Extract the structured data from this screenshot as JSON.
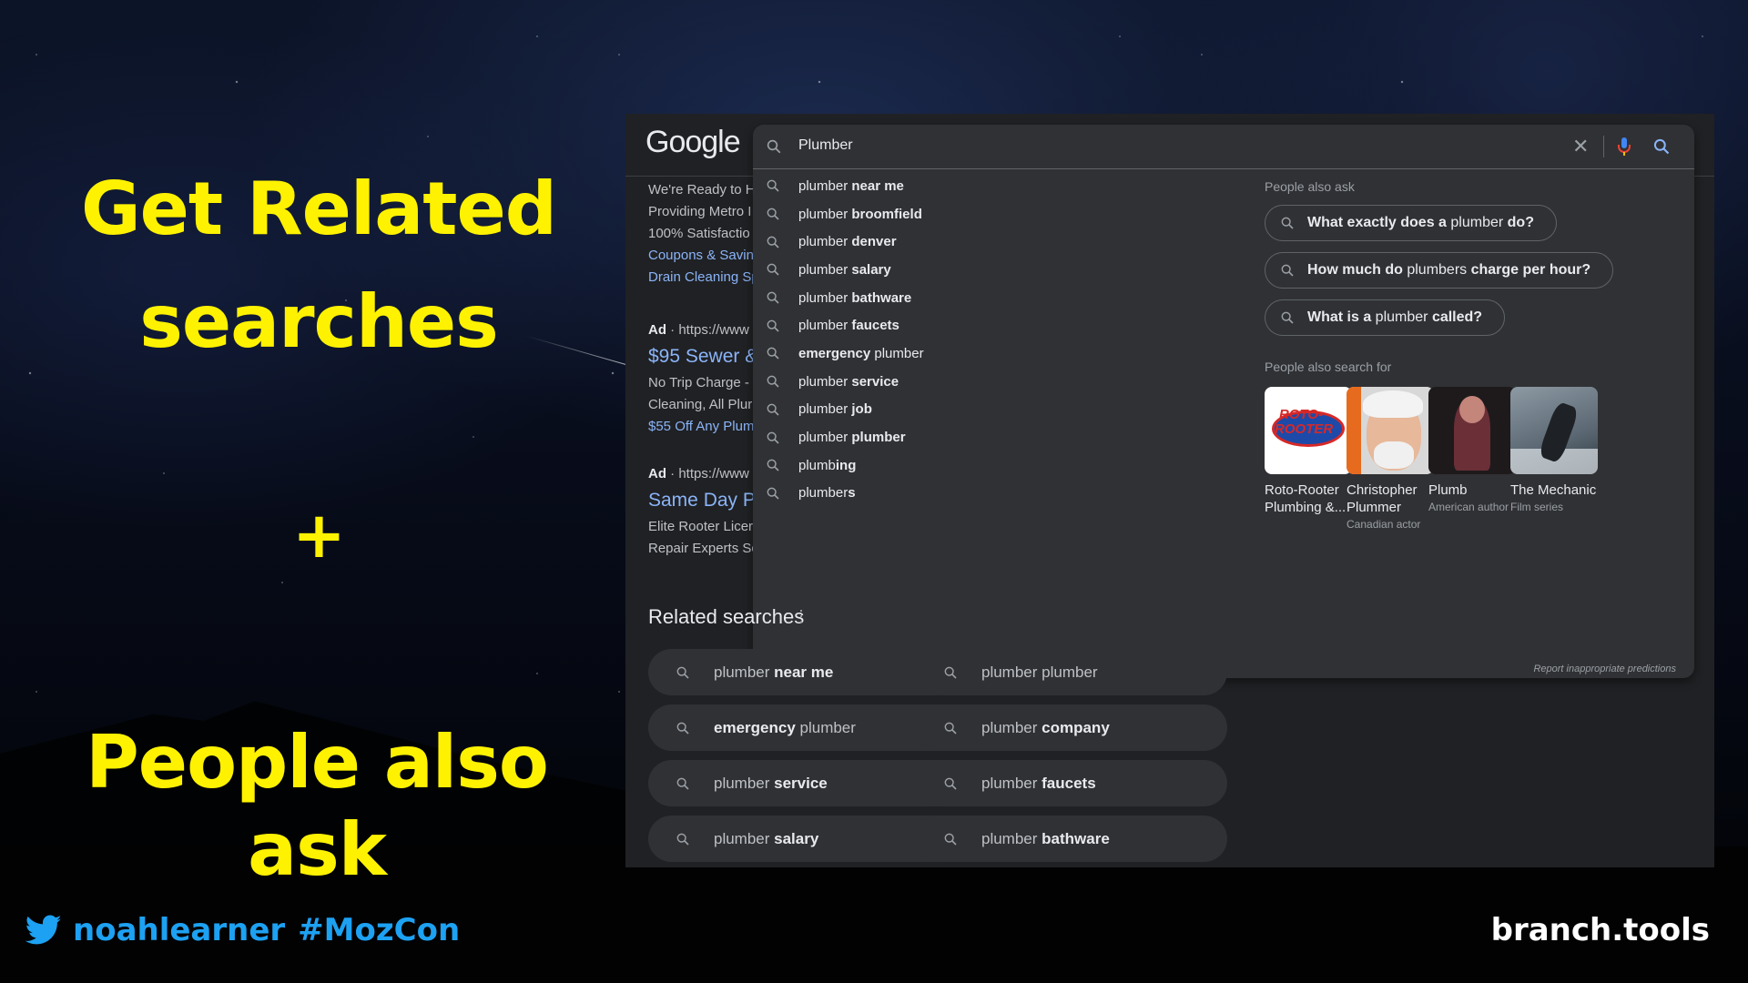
{
  "headline": {
    "line1": "Get Related",
    "line2": "searches",
    "plus": "+",
    "line3": "People also ask"
  },
  "footer": {
    "handle": "noahlearner",
    "hashtag": "#MozCon",
    "site": "branch.tools",
    "twitter_color": "#1da1f2"
  },
  "google": {
    "logo": "Google",
    "query": "Plumber",
    "ads": {
      "text_lines": [
        "We're Ready to H",
        "Providing Metro I",
        "100% Satisfactio"
      ],
      "links": [
        "Coupons & Savin",
        "Drain Cleaning Sp"
      ],
      "ad2_label": "Ad",
      "ad2_url": " · https://www",
      "ad2_title": "$95 Sewer &",
      "ad2_lines": [
        "No Trip Charge - ",
        "Cleaning, All Plur"
      ],
      "ad2_link": "$55 Off Any Plum",
      "ad3_label": "Ad",
      "ad3_url": " · https://www",
      "ad3_title": "Same Day P",
      "ad3_lines": [
        "Elite Rooter Licer",
        "Repair Experts Sc"
      ]
    },
    "suggestions": [
      {
        "prefix": "plumber ",
        "bold": "near me",
        "suffix": ""
      },
      {
        "prefix": "plumber ",
        "bold": "broomfield",
        "suffix": ""
      },
      {
        "prefix": "plumber ",
        "bold": "denver",
        "suffix": ""
      },
      {
        "prefix": "plumber ",
        "bold": "salary",
        "suffix": ""
      },
      {
        "prefix": "plumber ",
        "bold": "bathware",
        "suffix": ""
      },
      {
        "prefix": "plumber ",
        "bold": "faucets",
        "suffix": ""
      },
      {
        "prefix": "",
        "bold": "emergency",
        "suffix": " plumber"
      },
      {
        "prefix": "plumber ",
        "bold": "service",
        "suffix": ""
      },
      {
        "prefix": "plumber ",
        "bold": "job",
        "suffix": ""
      },
      {
        "prefix": "plumber ",
        "bold": "plumber",
        "suffix": ""
      },
      {
        "prefix": "plumb",
        "bold": "ing",
        "suffix": ""
      },
      {
        "prefix": "plumber",
        "bold": "s",
        "suffix": ""
      }
    ],
    "people_also_ask": {
      "title": "People also ask",
      "questions": [
        {
          "b1": "What exactly does a",
          "t": " plumber ",
          "b2": "do?"
        },
        {
          "b1": "How much do",
          "t": " plumbers ",
          "b2": "charge per hour?"
        },
        {
          "b1": "What is a",
          "t": " plumber ",
          "b2": "called?"
        }
      ]
    },
    "people_also_search": {
      "title": "People also search for",
      "items": [
        {
          "name": "Roto-Rooter Plumbing &...",
          "sub": "",
          "logo1": "ROTO-",
          "logo2": "ROOTER"
        },
        {
          "name": "Christopher Plummer",
          "sub": "Canadian actor"
        },
        {
          "name": "Plumb",
          "sub": "American author"
        },
        {
          "name": "The Mechanic",
          "sub": "Film series"
        }
      ]
    },
    "report": "Report inappropriate predictions",
    "related": {
      "title": "Related searches",
      "items": [
        {
          "prefix": "plumber ",
          "bold": "near me",
          "suffix": ""
        },
        {
          "prefix": "plumber plumber",
          "bold": "",
          "suffix": ""
        },
        {
          "prefix": "",
          "bold": "emergency",
          "suffix": " plumber"
        },
        {
          "prefix": "plumber ",
          "bold": "company",
          "suffix": ""
        },
        {
          "prefix": "plumber ",
          "bold": "service",
          "suffix": ""
        },
        {
          "prefix": "plumber ",
          "bold": "faucets",
          "suffix": ""
        },
        {
          "prefix": "plumber ",
          "bold": "salary",
          "suffix": ""
        },
        {
          "prefix": "plumber ",
          "bold": "bathware",
          "suffix": ""
        }
      ]
    }
  },
  "colors": {
    "headline": "#fff200",
    "panel_bg": "#202124",
    "dropdown_bg": "#303134",
    "link": "#8ab4f8"
  }
}
